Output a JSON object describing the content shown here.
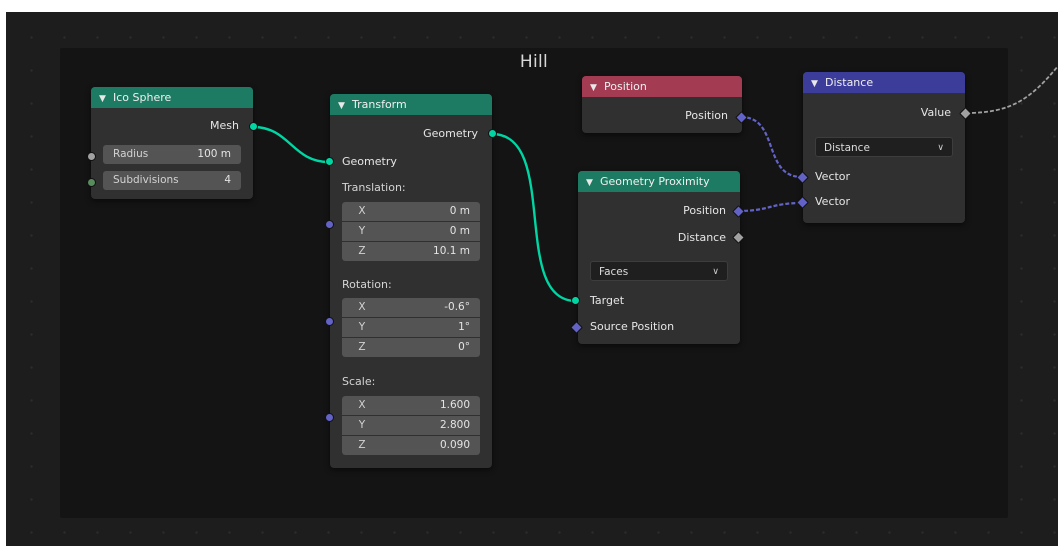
{
  "frame": {
    "title": "Hill"
  },
  "colors": {
    "geometry_header": "#1d7b63",
    "input_header": "#a33b52",
    "vector_header": "#3c3c9b",
    "geometry_socket": "#00d6a3",
    "vector_socket": "#6363c7",
    "float_socket": "#a1a1a1"
  },
  "nodes": {
    "ico_sphere": {
      "title": "Ico Sphere",
      "output_mesh": "Mesh",
      "radius_label": "Radius",
      "radius_value": "100 m",
      "subdivisions_label": "Subdivisions",
      "subdivisions_value": "4"
    },
    "transform": {
      "title": "Transform",
      "output_geometry": "Geometry",
      "input_geometry": "Geometry",
      "translation_label": "Translation:",
      "translation": [
        {
          "axis": "X",
          "value": "0 m"
        },
        {
          "axis": "Y",
          "value": "0 m"
        },
        {
          "axis": "Z",
          "value": "10.1 m"
        }
      ],
      "rotation_label": "Rotation:",
      "rotation": [
        {
          "axis": "X",
          "value": "-0.6°"
        },
        {
          "axis": "Y",
          "value": "1°"
        },
        {
          "axis": "Z",
          "value": "0°"
        }
      ],
      "scale_label": "Scale:",
      "scale": [
        {
          "axis": "X",
          "value": "1.600"
        },
        {
          "axis": "Y",
          "value": "2.800"
        },
        {
          "axis": "Z",
          "value": "0.090"
        }
      ]
    },
    "position": {
      "title": "Position",
      "output_position": "Position"
    },
    "geometry_proximity": {
      "title": "Geometry Proximity",
      "output_position": "Position",
      "output_distance": "Distance",
      "mode": "Faces",
      "input_target": "Target",
      "input_source_position": "Source Position"
    },
    "distance": {
      "title": "Distance",
      "output_value": "Value",
      "operation": "Distance",
      "input_vector_1": "Vector",
      "input_vector_2": "Vector"
    }
  },
  "icons": {
    "collapse": "chevron-down-icon",
    "dropdown": "chevron-down-icon"
  }
}
